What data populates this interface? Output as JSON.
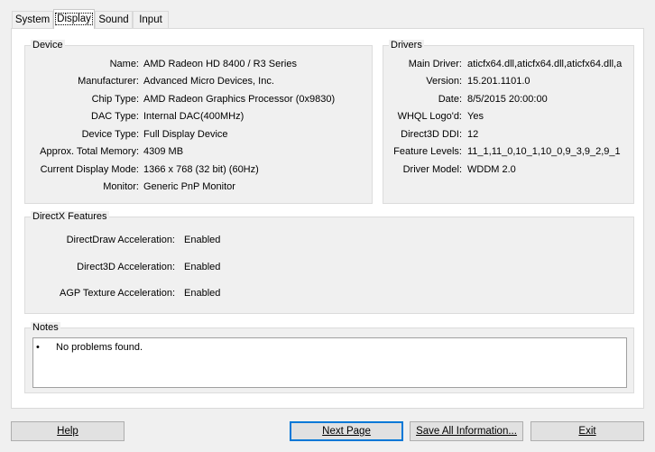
{
  "tabs": [
    "System",
    "Display",
    "Sound",
    "Input"
  ],
  "device": {
    "title": "Device",
    "rows": [
      {
        "label": "Name:",
        "value": "AMD Radeon HD 8400 / R3 Series"
      },
      {
        "label": "Manufacturer:",
        "value": "Advanced Micro Devices, Inc."
      },
      {
        "label": "Chip Type:",
        "value": "AMD Radeon Graphics Processor (0x9830)"
      },
      {
        "label": "DAC Type:",
        "value": "Internal DAC(400MHz)"
      },
      {
        "label": "Device Type:",
        "value": "Full Display Device"
      },
      {
        "label": "Approx. Total Memory:",
        "value": "4309 MB"
      },
      {
        "label": "Current Display Mode:",
        "value": "1366 x 768 (32 bit) (60Hz)"
      },
      {
        "label": "Monitor:",
        "value": "Generic PnP Monitor"
      }
    ]
  },
  "drivers": {
    "title": "Drivers",
    "rows": [
      {
        "label": "Main Driver:",
        "value": "aticfx64.dll,aticfx64.dll,aticfx64.dll,a"
      },
      {
        "label": "Version:",
        "value": "15.201.1101.0"
      },
      {
        "label": "Date:",
        "value": "8/5/2015 20:00:00"
      },
      {
        "label": "WHQL Logo'd:",
        "value": "Yes"
      },
      {
        "label": "Direct3D DDI:",
        "value": "12"
      },
      {
        "label": "Feature Levels:",
        "value": "11_1,11_0,10_1,10_0,9_3,9_2,9_1"
      },
      {
        "label": "Driver Model:",
        "value": "WDDM 2.0"
      }
    ]
  },
  "directx": {
    "title": "DirectX Features",
    "rows": [
      {
        "label": "DirectDraw Acceleration:",
        "value": "Enabled"
      },
      {
        "label": "Direct3D Acceleration:",
        "value": "Enabled"
      },
      {
        "label": "AGP Texture Acceleration:",
        "value": "Enabled"
      }
    ]
  },
  "notes": {
    "title": "Notes",
    "bullet": "•",
    "items": [
      "No problems found."
    ]
  },
  "buttons": {
    "help": "Help",
    "next_page": "Next Page",
    "save_all": "Save All Information...",
    "exit": "Exit"
  }
}
